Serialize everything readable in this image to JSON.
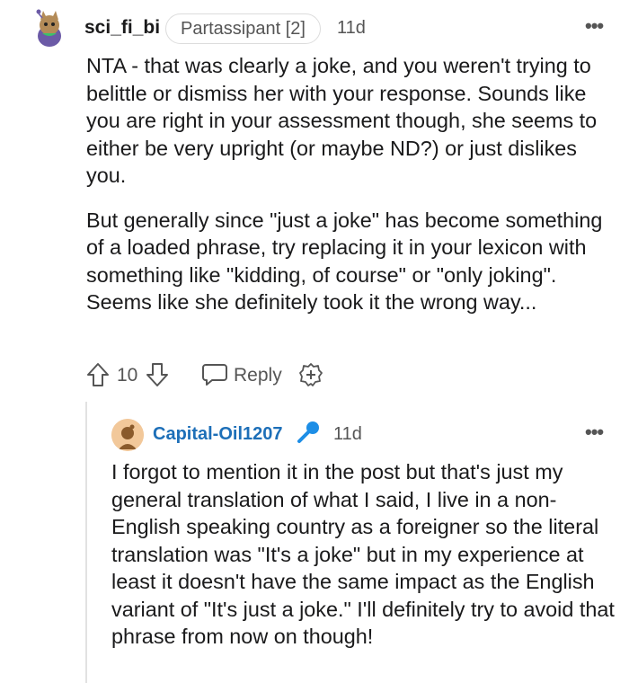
{
  "comment": {
    "username": "sci_fi_bi",
    "flair": "Partassipant [2]",
    "time": "11d",
    "more": "•••",
    "paragraphs": [
      "NTA - that was clearly a joke, and you weren't trying to belittle or dismiss her with your response. Sounds like you are right in your assessment though, she seems to either be very upright (or maybe ND?) or just dislikes you.",
      "But generally since \"just a joke\" has become something of a loaded phrase, try replacing it in your lexicon with something like \"kidding, of course\" or \"only joking\". Seems like she definitely took it the wrong way..."
    ],
    "votes": "10",
    "reply_label": "Reply"
  },
  "reply": {
    "username": "Capital-Oil1207",
    "time": "11d",
    "more": "•••",
    "body": "I forgot to mention it in the post but that's just my general translation of what I said, I live in a non-English speaking country as a foreigner so the literal translation was \"It's a joke\" but in my experience at least it doesn't have the same impact as the English variant of \"It's just a joke.\" I'll definitely try to avoid that phrase from now on though!"
  },
  "colors": {
    "op_username": "#1d6fb8",
    "mic": "#1d8ee6",
    "muted": "#555555"
  }
}
